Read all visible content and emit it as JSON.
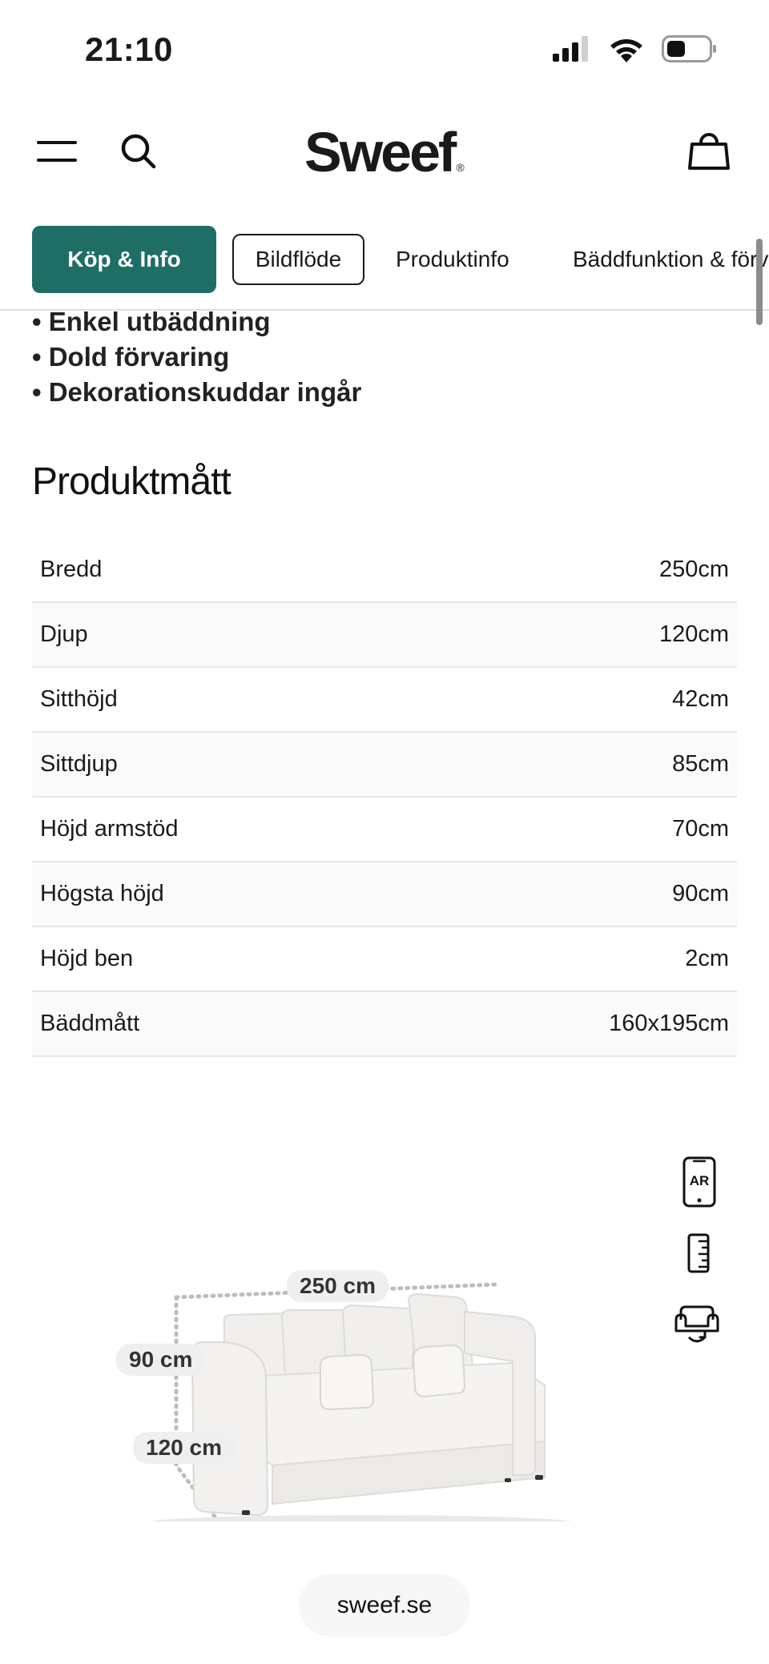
{
  "status_bar": {
    "time": "21:10"
  },
  "header": {
    "logo_text": "Sweef",
    "logo_mark": "®",
    "icons": [
      "menu-icon",
      "search-icon",
      "cart-icon"
    ]
  },
  "tabs": [
    {
      "label": "Köp & Info",
      "active": true
    },
    {
      "label": "Bildflöde",
      "active": false
    },
    {
      "label": "Produktinfo",
      "active": false
    },
    {
      "label": "Bäddfunktion & förvaring",
      "active": false
    }
  ],
  "features": [
    "• Enkel utbäddning",
    "• Dold förvaring",
    "• Dekorationskuddar ingår"
  ],
  "dimensions": {
    "title": "Produktmått",
    "rows": [
      {
        "label": "Bredd",
        "value": "250cm"
      },
      {
        "label": "Djup",
        "value": "120cm"
      },
      {
        "label": "Sitthöjd",
        "value": "42cm"
      },
      {
        "label": "Sittdjup",
        "value": "85cm"
      },
      {
        "label": "Höjd armstöd",
        "value": "70cm"
      },
      {
        "label": "Högsta höjd",
        "value": "90cm"
      },
      {
        "label": "Höjd ben",
        "value": "2cm"
      },
      {
        "label": "Bäddmått",
        "value": "160x195cm"
      }
    ]
  },
  "viewer": {
    "ar_label": "AR",
    "width_label": "250 cm",
    "height_label": "90 cm",
    "depth_label": "120 cm"
  },
  "footer": {
    "url": "sweef.se"
  },
  "colors": {
    "accent": "#1f6e66",
    "text": "#1a1a1a",
    "row_alt": "#fafafa",
    "divider": "#e6e6e6"
  }
}
